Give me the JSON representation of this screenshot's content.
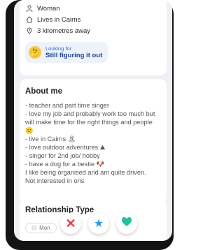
{
  "profile": {
    "gender": "Woman",
    "lives_in": "Lives in Cairns",
    "distance": "3 kilometres away"
  },
  "looking_for": {
    "label": "Looking for",
    "value": "Still figuring it out"
  },
  "about": {
    "title": "About me",
    "text": "- teacher and part time singer\n- love my job and probably work too much but will make time for the right things and people 🙂\n- live in Cairns 🏝\n- love outdoor adventures ⛰\n- singer for 2nd job/ hobby\n- have a dog for a bestie 🐶\nI like being organised and am quite driven.\nNot interested in ons"
  },
  "relationship": {
    "title": "Relationship Type",
    "chip": "Mon"
  },
  "actions": {
    "nope_icon": "close-icon",
    "super_like_icon": "star-icon",
    "like_icon": "heart-icon",
    "colors": {
      "nope": "#e83a4f",
      "super_like": "#22a0e5",
      "like": "#21c29a"
    }
  }
}
